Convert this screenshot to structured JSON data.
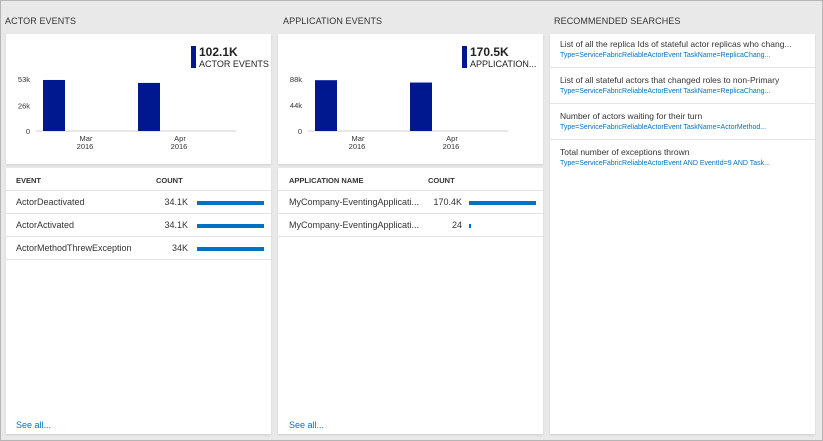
{
  "actor_events": {
    "title": "ACTOR EVENTS",
    "summary": {
      "value": "102.1K",
      "label": "ACTOR EVENTS"
    },
    "columns": {
      "name": "EVENT",
      "count": "COUNT"
    },
    "rows": [
      {
        "name": "ActorDeactivated",
        "count": "34.1K",
        "fraction": 1.0
      },
      {
        "name": "ActorActivated",
        "count": "34.1K",
        "fraction": 1.0
      },
      {
        "name": "ActorMethodThrewException",
        "count": "34K",
        "fraction": 0.997
      }
    ],
    "see_all": "See all..."
  },
  "application_events": {
    "title": "APPLICATION EVENTS",
    "summary": {
      "value": "170.5K",
      "label": "APPLICATION..."
    },
    "columns": {
      "name": "APPLICATION NAME",
      "count": "COUNT"
    },
    "rows": [
      {
        "name": "MyCompany-EventingApplicati...",
        "count": "170.4K",
        "fraction": 1.0
      },
      {
        "name": "MyCompany-EventingApplicati...",
        "count": "24",
        "fraction": 0.0001
      }
    ],
    "see_all": "See all..."
  },
  "recommended_searches": {
    "title": "RECOMMENDED SEARCHES",
    "items": [
      {
        "title": "List of all the replica Ids of stateful actor replicas who chang...",
        "query": "Type=ServiceFabricReliableActorEvent TaskName=ReplicaChang..."
      },
      {
        "title": "List of all stateful actors that changed roles to non-Primary",
        "query": "Type=ServiceFabricReliableActorEvent TaskName=ReplicaChang..."
      },
      {
        "title": "Number of actors waiting for their turn",
        "query": "Type=ServiceFabricReliableActorEvent TaskName=ActorMethod..."
      },
      {
        "title": "Total number of exceptions thrown",
        "query": "Type=ServiceFabricReliableActorEvent AND EventId=9 AND Task..."
      }
    ]
  },
  "colors": {
    "chart_bar": "#00188f",
    "count_bar": "#0072c6",
    "link": "#0072c6"
  },
  "chart_data": [
    {
      "type": "bar",
      "title": "",
      "categories": [
        "Mar 2016",
        "Apr 2016"
      ],
      "x_tick_labels": [
        {
          "line1": "Mar",
          "line2": "2016"
        },
        {
          "line1": "Apr",
          "line2": "2016"
        }
      ],
      "y_tick_labels": [
        "53k",
        "26k",
        "0"
      ],
      "y_ticks": [
        53,
        26,
        0
      ],
      "ylim": [
        0,
        53
      ],
      "values": [
        52,
        49
      ],
      "value_unit": "k"
    },
    {
      "type": "bar",
      "title": "",
      "categories": [
        "Mar 2016",
        "Apr 2016"
      ],
      "x_tick_labels": [
        {
          "line1": "Mar",
          "line2": "2016"
        },
        {
          "line1": "Apr",
          "line2": "2016"
        }
      ],
      "y_tick_labels": [
        "88k",
        "44k",
        "0"
      ],
      "y_ticks": [
        88,
        44,
        0
      ],
      "ylim": [
        0,
        88
      ],
      "values": [
        86,
        82
      ],
      "value_unit": "k"
    }
  ]
}
